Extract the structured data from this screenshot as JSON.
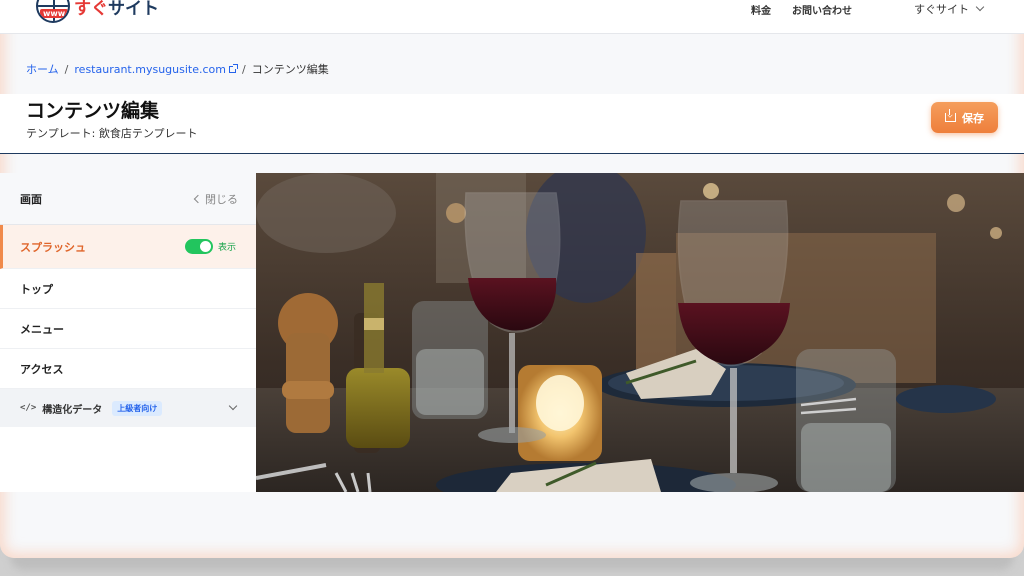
{
  "header": {
    "logo_www": "www",
    "logo_text_red": "すぐ",
    "logo_text_blue": "サイト",
    "nav": {
      "pricing": "料金",
      "contact": "お問い合わせ",
      "user": "すぐサイト"
    }
  },
  "breadcrumb": {
    "home": "ホーム",
    "site": "restaurant.mysugusite.com",
    "current": "コンテンツ編集"
  },
  "page": {
    "title": "コンテンツ編集",
    "subtitle": "テンプレート: 飲食店テンプレート",
    "save_label": "保存"
  },
  "sidebar": {
    "title": "画面",
    "close_label": "閉じる",
    "items": [
      {
        "label": "スプラッシュ",
        "active": true,
        "toggle_label": "表示",
        "toggle_on": true
      },
      {
        "label": "トップ"
      },
      {
        "label": "メニュー"
      },
      {
        "label": "アクセス"
      }
    ],
    "structured": {
      "icon": "</>",
      "label": "構造化データ",
      "badge": "上級者向け"
    }
  },
  "colors": {
    "accent": "#ee7f3b",
    "link": "#2563eb",
    "toggle": "#22c55e",
    "brand_red": "#e53935",
    "brand_blue": "#1e3a5f"
  },
  "icons": [
    "external-link-icon",
    "save-icon",
    "chevron-down-icon",
    "chevron-left-icon",
    "code-icon"
  ]
}
